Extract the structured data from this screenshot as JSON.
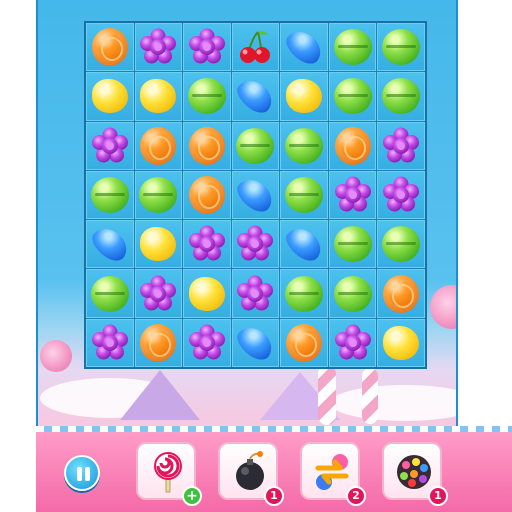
{
  "colors": {
    "board": "#1f7fb6",
    "cell": "#45baea",
    "bottom_bar": "#f46aa8",
    "accent_blue": "#1893d8",
    "badge_red": "#e3145a",
    "badge_green": "#3cc23c"
  },
  "board": {
    "rows": 7,
    "cols": 7,
    "grid": [
      [
        "orange",
        "flower",
        "flower",
        "cherry",
        "blue",
        "lime",
        "lime"
      ],
      [
        "lemon",
        "lemon",
        "lime",
        "blue",
        "lemon",
        "lime",
        "lime"
      ],
      [
        "flower",
        "orange",
        "orange",
        "lime",
        "lime",
        "orange",
        "flower"
      ],
      [
        "lime",
        "lime",
        "orange",
        "blue",
        "lime",
        "flower",
        "flower"
      ],
      [
        "blue",
        "lemon",
        "flower",
        "flower",
        "blue",
        "lime",
        "lime"
      ],
      [
        "lime",
        "flower",
        "lemon",
        "flower",
        "lime",
        "lime",
        "orange"
      ],
      [
        "flower",
        "orange",
        "flower",
        "blue",
        "orange",
        "flower",
        "lemon"
      ]
    ]
  },
  "controls": {
    "pause_icon": "pause-icon"
  },
  "boosters": [
    {
      "name": "lollipop-hammer",
      "icon": "lollipop-icon",
      "badge": "+"
    },
    {
      "name": "bomb",
      "icon": "bomb-icon",
      "badge": "1"
    },
    {
      "name": "swap",
      "icon": "swap-arrows-icon",
      "badge": "2"
    },
    {
      "name": "color-bomb",
      "icon": "color-bomb-icon",
      "badge": "1"
    }
  ]
}
